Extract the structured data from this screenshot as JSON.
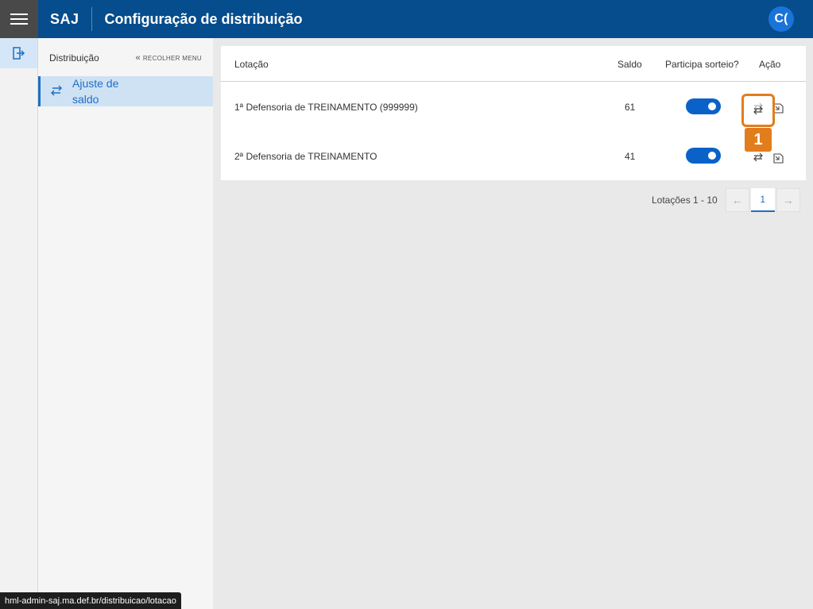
{
  "header": {
    "brand": "SAJ",
    "title": "Configuração de distribuição",
    "avatar_initials": "C("
  },
  "rail": {
    "active_icon": "distribution-icon"
  },
  "sidebar": {
    "title": "Distribuição",
    "collapse_label": "RECOLHER MENU",
    "items": [
      {
        "label_line1": "Ajuste de",
        "label_line2": "saldo",
        "icon": "transfer-icon"
      }
    ]
  },
  "table": {
    "columns": [
      "Lotação",
      "Saldo",
      "Participa sorteio?",
      "Ação"
    ],
    "rows": [
      {
        "lotacao": "1ª Defensoria de TREINAMENTO (999999)",
        "saldo": "61",
        "participa": true
      },
      {
        "lotacao": "2ª Defensoria de TREINAMENTO",
        "saldo": "41",
        "participa": true
      }
    ]
  },
  "annotation": {
    "badge": "1"
  },
  "pagination": {
    "label": "Lotações 1 - 10",
    "current_page": "1",
    "prev_symbol": "←",
    "next_symbol": "→"
  },
  "statusbar": {
    "url": "hml-admin-saj.ma.def.br/distribuicao/lotacao"
  },
  "colors": {
    "header": "#054d8c",
    "accent": "#1f6fc2",
    "toggle_on": "#0a62c9",
    "highlight": "#e27d1c"
  }
}
